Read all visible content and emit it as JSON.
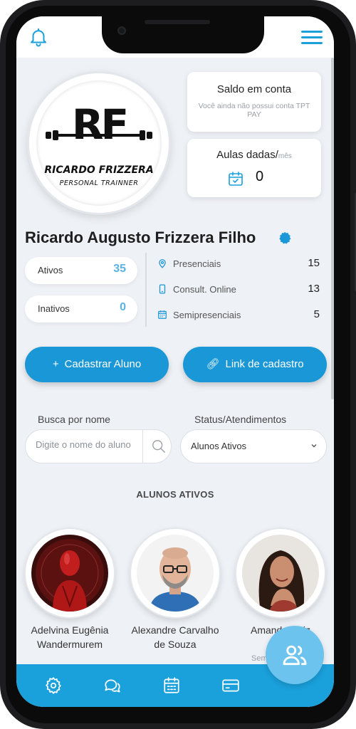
{
  "profile": {
    "logo_initials": "RF",
    "logo_name": "RICARDO FRIZZERA",
    "logo_subtitle": "PERSONAL TRAINNER",
    "name": "Ricardo Augusto Frizzera Filho"
  },
  "balance_card": {
    "title": "Saldo em conta",
    "subtitle": "Você ainda não possui conta TPT PAY"
  },
  "classes_card": {
    "title": "Aulas dadas/",
    "period": "mês",
    "count": "0"
  },
  "stats": {
    "active_label": "Ativos",
    "active_value": "35",
    "inactive_label": "Inativos",
    "inactive_value": "0"
  },
  "modalities": [
    {
      "label": "Presenciais",
      "value": "15",
      "icon": "location-pin-icon"
    },
    {
      "label": "Consult. Online",
      "value": "13",
      "icon": "phone-icon"
    },
    {
      "label": "Semipresenciais",
      "value": "5",
      "icon": "calendar-grid-icon"
    }
  ],
  "actions": {
    "register_student": "Cadastrar Aluno",
    "register_link": "Link de cadastro"
  },
  "filters": {
    "search_label": "Busca por nome",
    "search_placeholder": "Digite o nome do aluno",
    "status_label": "Status/Atendimentos",
    "status_value": "Alunos Ativos"
  },
  "section_title": "ALUNOS ATIVOS",
  "students": [
    {
      "name": "Adelvina Eugênia Wandermurem"
    },
    {
      "name": "Alexandre Carvalho de Souza"
    },
    {
      "name": "Amanda Ririz",
      "badge": "Sem"
    }
  ],
  "colors": {
    "primary": "#1aa0db",
    "button": "#1a97d6",
    "accent_light": "#6cc3ee",
    "stat_value": "#5ab3e6",
    "background": "#eef1f6"
  },
  "icons": {
    "top_left": "bell-icon",
    "top_right": "hamburger-menu-icon",
    "nav": [
      "settings-gear-icon",
      "chat-bubbles-icon",
      "calendar-icon",
      "credit-card-icon"
    ],
    "fab": "users-icon"
  }
}
